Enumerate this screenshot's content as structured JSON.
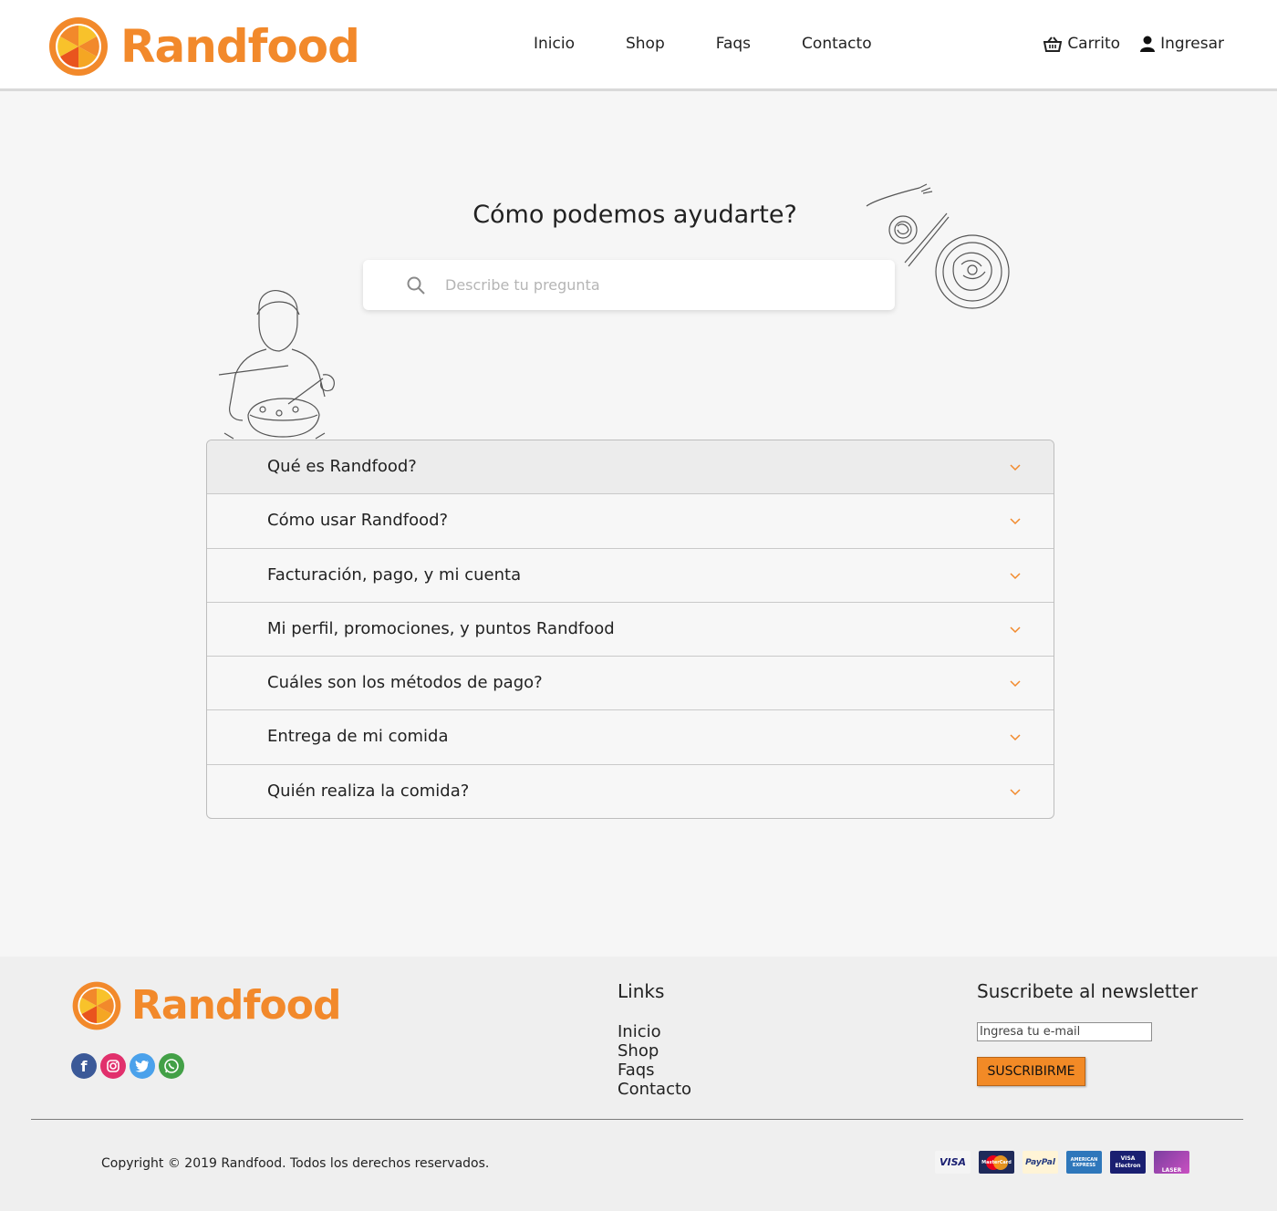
{
  "brand": {
    "name": "Randfood",
    "accent_color": "#f2892b"
  },
  "header": {
    "nav": [
      "Inicio",
      "Shop",
      "Faqs",
      "Contacto"
    ],
    "cart_label": "Carrito",
    "login_label": "Ingresar",
    "cart_icon": "basket-icon",
    "login_icon": "user-icon"
  },
  "hero": {
    "title": "Cómo podemos ayudarte?",
    "search_placeholder": "Describe tu pregunta",
    "search_icon": "search-icon"
  },
  "faq": {
    "items": [
      {
        "question": "Qué es Randfood?",
        "active": true
      },
      {
        "question": "Cómo usar Randfood?",
        "active": false
      },
      {
        "question": "Facturación, pago, y mi cuenta",
        "active": false
      },
      {
        "question": "Mi perfil, promociones, y puntos Randfood",
        "active": false
      },
      {
        "question": "Cuáles son los métodos de pago?",
        "active": false
      },
      {
        "question": "Entrega de mi comida",
        "active": false
      },
      {
        "question": "Quién realiza la comida?",
        "active": false
      }
    ]
  },
  "footer": {
    "social": [
      "facebook-icon",
      "instagram-icon",
      "twitter-icon",
      "whatsapp-icon"
    ],
    "links_title": "Links",
    "links": [
      "Inicio",
      "Shop",
      "Faqs",
      "Contacto"
    ],
    "newsletter_title": "Suscribete al newsletter",
    "newsletter_placeholder": "Ingresa tu e-mail",
    "newsletter_button": "SUSCRIBIRME",
    "copyright": "Copyright © 2019 Randfood. Todos los derechos reservados.",
    "payment_methods": [
      "VISA",
      "MasterCard",
      "PayPal",
      "AMERICAN EXPRESS",
      "VISA Electron",
      "LASER"
    ]
  }
}
